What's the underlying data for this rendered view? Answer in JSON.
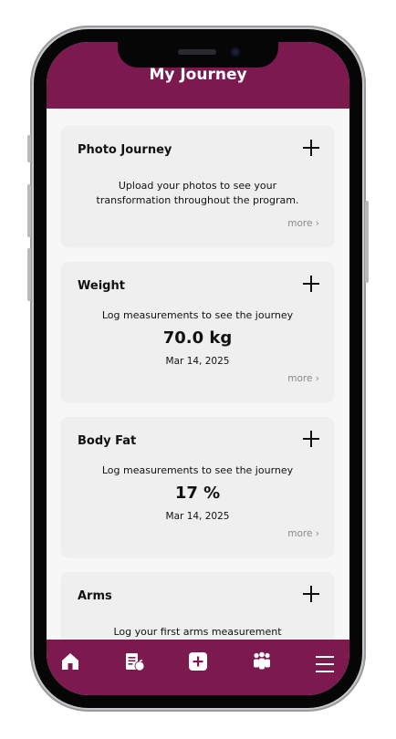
{
  "header": {
    "title": "My Journey"
  },
  "cards": [
    {
      "title": "Photo Journey",
      "description": "Upload your photos to see your transformation throughout the program.",
      "more": "more"
    },
    {
      "title": "Weight",
      "description": "Log measurements to see the journey",
      "value": "70.0 kg",
      "date": "Mar 14, 2025",
      "more": "more"
    },
    {
      "title": "Body Fat",
      "description": "Log measurements to see the journey",
      "value": "17 %",
      "date": "Mar 14, 2025",
      "more": "more"
    },
    {
      "title": "Arms",
      "description": "Log your first arms measurement"
    }
  ],
  "nav": {
    "items": [
      {
        "icon": "home-icon"
      },
      {
        "icon": "log-nutrition-icon"
      },
      {
        "icon": "add-icon"
      },
      {
        "icon": "community-icon"
      },
      {
        "icon": "menu-icon"
      }
    ]
  },
  "colors": {
    "brand": "#7c1a4f",
    "background": "#f7f7f7",
    "card": "#efefef"
  }
}
